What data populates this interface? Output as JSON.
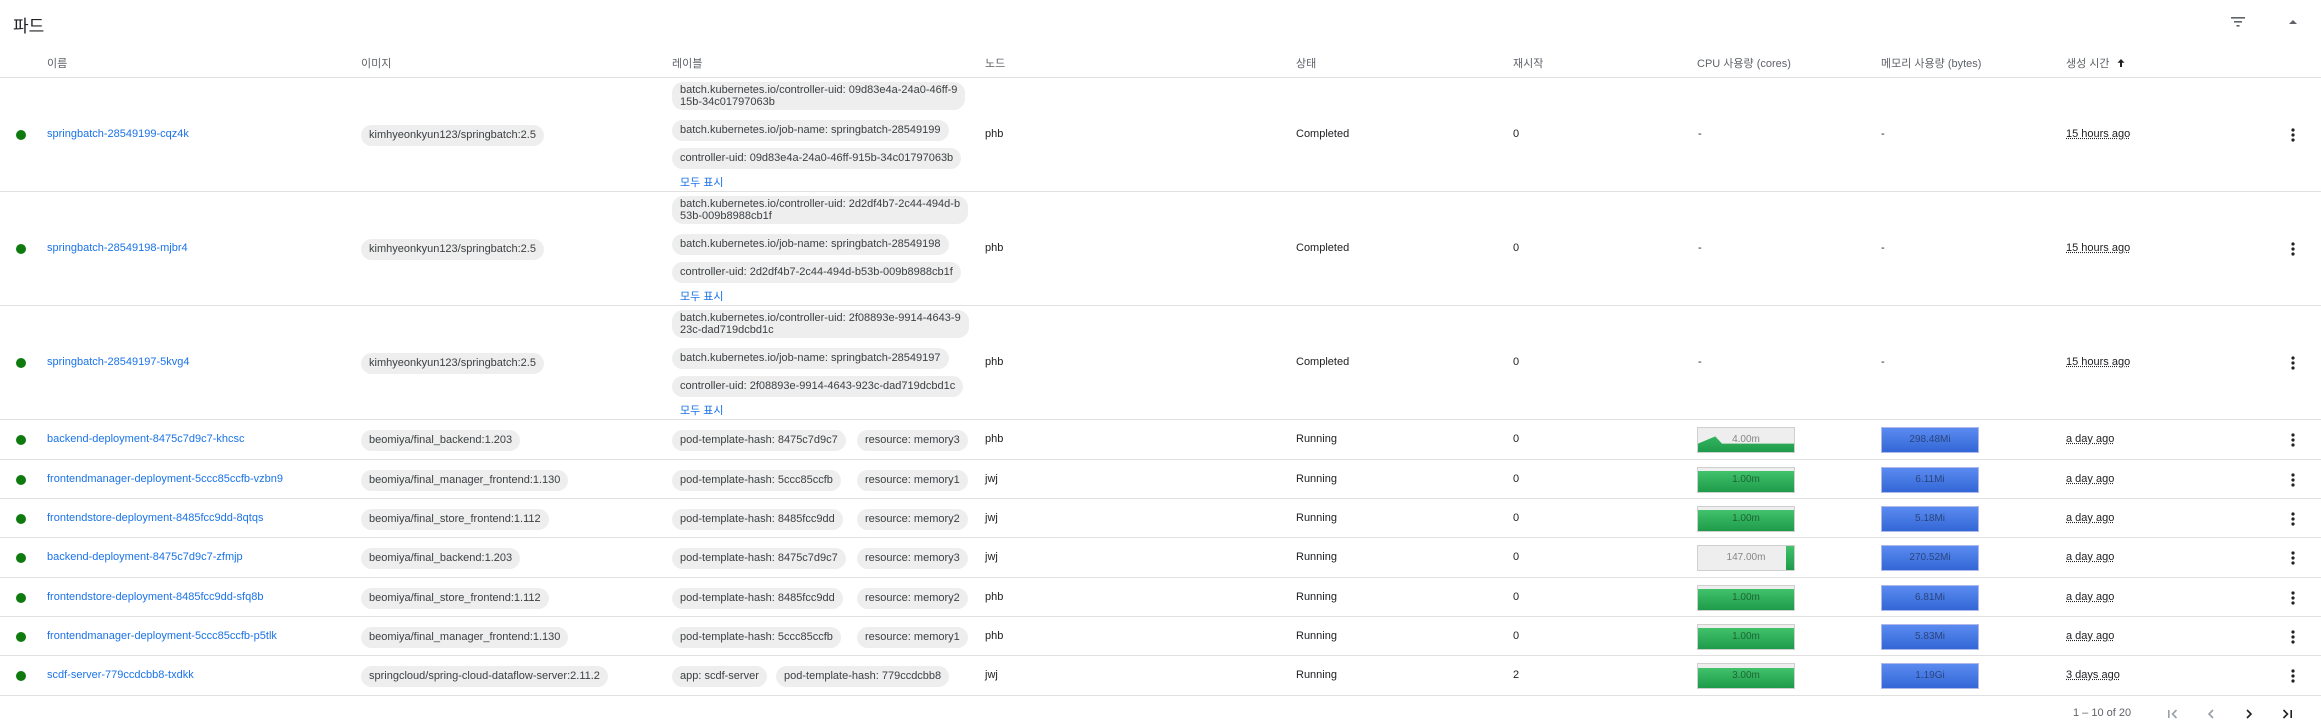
{
  "panel": {
    "title": "파드",
    "filter_icon": "filter-list-icon",
    "collapse_icon": "chevron-up-icon"
  },
  "columns": {
    "name": "이름",
    "image": "이미지",
    "labels": "레이블",
    "node": "노드",
    "status": "상태",
    "restarts": "재시작",
    "cpu": "CPU 사용량 (cores)",
    "memory": "메모리 사용량 (bytes)",
    "created": "생성 시간"
  },
  "show_all_label": "모두 표시",
  "colors": {
    "status_ok": "#0f7b0f",
    "link": "#1a73e8",
    "cpu_spark": "#1e9b4a",
    "mem_spark": "#3367d6"
  },
  "pods": [
    {
      "name": "springbatch-28549199-cqz4k",
      "image": "kimhyeonkyun123/springbatch:2.5",
      "labels": [
        "batch.kubernetes.io/controller-uid: 09d83e4a-24a0-46ff-9\n15b-34c01797063b",
        "batch.kubernetes.io/job-name: springbatch-28549199",
        "controller-uid: 09d83e4a-24a0-46ff-915b-34c01797063b"
      ],
      "node": "phb",
      "status": "Completed",
      "restarts": "0",
      "cpu": "-",
      "memory": "-",
      "age": "15 hours ago"
    },
    {
      "name": "springbatch-28549198-mjbr4",
      "image": "kimhyeonkyun123/springbatch:2.5",
      "labels": [
        "batch.kubernetes.io/controller-uid: 2d2df4b7-2c44-494d-b\n53b-009b8988cb1f",
        "batch.kubernetes.io/job-name: springbatch-28549198",
        "controller-uid: 2d2df4b7-2c44-494d-b53b-009b8988cb1f"
      ],
      "node": "phb",
      "status": "Completed",
      "restarts": "0",
      "cpu": "-",
      "memory": "-",
      "age": "15 hours ago"
    },
    {
      "name": "springbatch-28549197-5kvg4",
      "image": "kimhyeonkyun123/springbatch:2.5",
      "labels": [
        "batch.kubernetes.io/controller-uid: 2f08893e-9914-4643-9\n23c-dad719dcbd1c",
        "batch.kubernetes.io/job-name: springbatch-28549197",
        "controller-uid: 2f08893e-9914-4643-923c-dad719dcbd1c"
      ],
      "node": "phb",
      "status": "Completed",
      "restarts": "0",
      "cpu": "-",
      "memory": "-",
      "age": "15 hours ago"
    },
    {
      "name": "backend-deployment-8475c7d9c7-khcsc",
      "image": "beomiya/final_backend:1.203",
      "labels": [
        "pod-template-hash: 8475c7d9c7",
        "resource: memory3"
      ],
      "node": "phb",
      "status": "Running",
      "restarts": "0",
      "cpu": "4.00m",
      "memory": "298.48Mi",
      "age": "a day ago"
    },
    {
      "name": "frontendmanager-deployment-5ccc85ccfb-vzbn9",
      "image": "beomiya/final_manager_frontend:1.130",
      "labels": [
        "pod-template-hash: 5ccc85ccfb",
        "resource: memory1"
      ],
      "node": "jwj",
      "status": "Running",
      "restarts": "0",
      "cpu": "1.00m",
      "memory": "6.11Mi",
      "age": "a day ago"
    },
    {
      "name": "frontendstore-deployment-8485fcc9dd-8qtqs",
      "image": "beomiya/final_store_frontend:1.112",
      "labels": [
        "pod-template-hash: 8485fcc9dd",
        "resource: memory2"
      ],
      "node": "jwj",
      "status": "Running",
      "restarts": "0",
      "cpu": "1.00m",
      "memory": "5.18Mi",
      "age": "a day ago"
    },
    {
      "name": "backend-deployment-8475c7d9c7-zfmjp",
      "image": "beomiya/final_backend:1.203",
      "labels": [
        "pod-template-hash: 8475c7d9c7",
        "resource: memory3"
      ],
      "node": "jwj",
      "status": "Running",
      "restarts": "0",
      "cpu": "147.00m",
      "memory": "270.52Mi",
      "age": "a day ago"
    },
    {
      "name": "frontendstore-deployment-8485fcc9dd-sfq8b",
      "image": "beomiya/final_store_frontend:1.112",
      "labels": [
        "pod-template-hash: 8485fcc9dd",
        "resource: memory2"
      ],
      "node": "phb",
      "status": "Running",
      "restarts": "0",
      "cpu": "1.00m",
      "memory": "6.81Mi",
      "age": "a day ago"
    },
    {
      "name": "frontendmanager-deployment-5ccc85ccfb-p5tlk",
      "image": "beomiya/final_manager_frontend:1.130",
      "labels": [
        "pod-template-hash: 5ccc85ccfb",
        "resource: memory1"
      ],
      "node": "phb",
      "status": "Running",
      "restarts": "0",
      "cpu": "1.00m",
      "memory": "5.83Mi",
      "age": "a day ago"
    },
    {
      "name": "scdf-server-779ccdcbb8-txdkk",
      "image": "springcloud/spring-cloud-dataflow-server:2.11.2",
      "labels": [
        "app: scdf-server",
        "pod-template-hash: 779ccdcbb8"
      ],
      "node": "jwj",
      "status": "Running",
      "restarts": "2",
      "cpu": "3.00m",
      "memory": "1.19Gi",
      "age": "3 days ago"
    }
  ],
  "paginator": {
    "range": "1 – 10 of 20",
    "first_icon": "first-page-icon",
    "prev_icon": "chevron-left-icon",
    "next_icon": "chevron-right-icon",
    "last_icon": "last-page-icon"
  }
}
